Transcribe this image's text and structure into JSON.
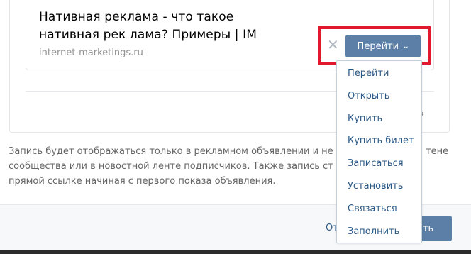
{
  "link_preview": {
    "title": "Нативная реклама - что такое нативная рек лама? Примеры | IM",
    "domain": "internet-marketings.ru",
    "close_symbol": "✕",
    "button_label": "Перейти",
    "button_chevron": "⌄"
  },
  "dropdown": {
    "items": [
      "Перейти",
      "Открыть",
      "Купить",
      "Купить билет",
      "Записаться",
      "Установить",
      "Связаться",
      "Заполнить"
    ]
  },
  "partial_char": "ᵖ",
  "note": {
    "text": "Запись будет отображаться только в рекламном объявлении и не сообщества или в новостной ленте подписчиков. Также запись ст прямой ссылке начиная с первого показа объявления.",
    "tail_line1": "тене",
    "tail_line2": ""
  },
  "footer": {
    "cancel_peek": "От",
    "save_peek": "ать"
  },
  "colors": {
    "accent_button": "#5b7fa6",
    "link_text": "#2a5885",
    "highlight": "#e3182e"
  }
}
